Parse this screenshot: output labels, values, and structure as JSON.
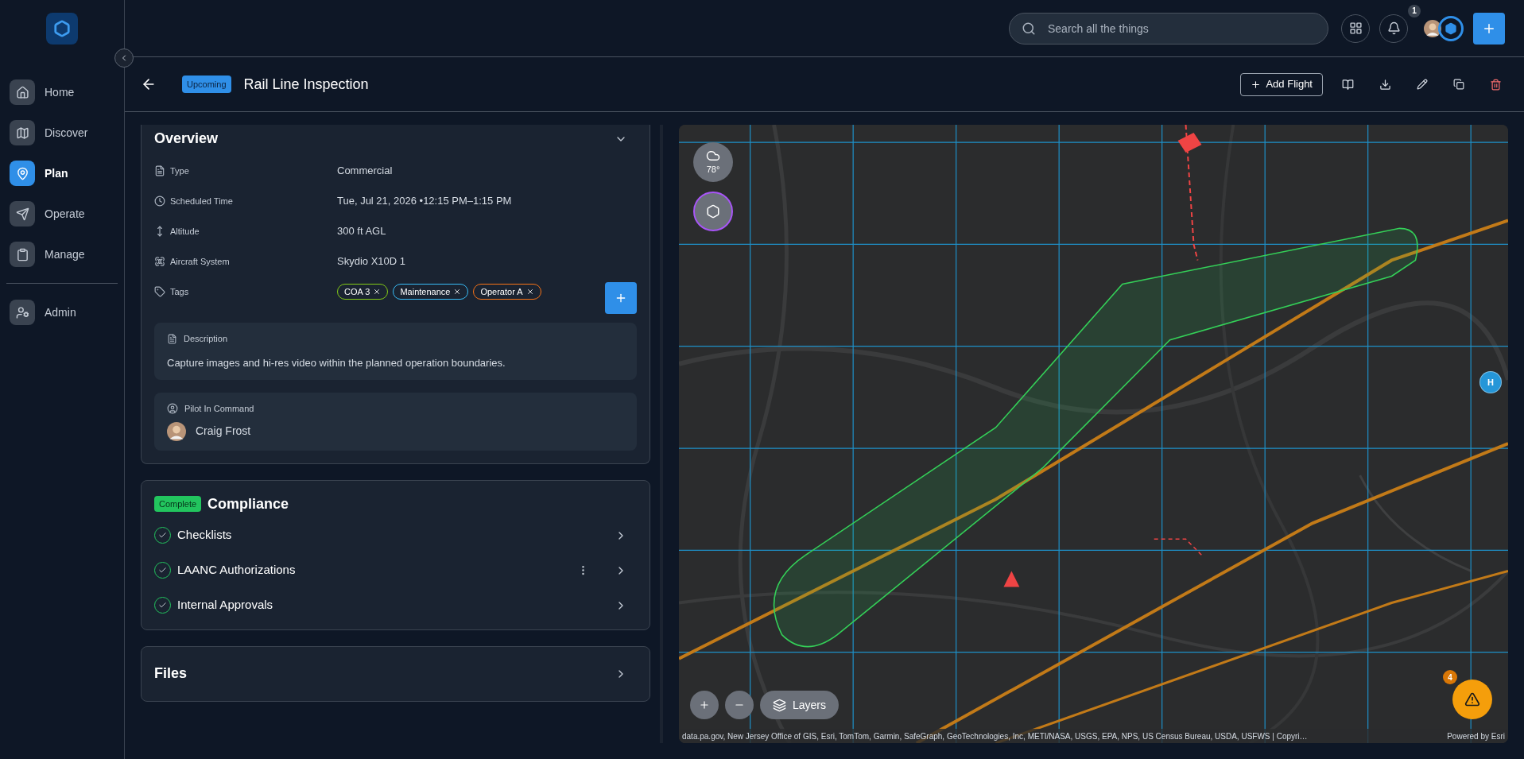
{
  "sidebar": {
    "items": [
      {
        "label": "Home",
        "selected": false
      },
      {
        "label": "Discover",
        "selected": false
      },
      {
        "label": "Plan",
        "selected": true
      },
      {
        "label": "Operate",
        "selected": false
      },
      {
        "label": "Manage",
        "selected": false
      }
    ],
    "footer_items": [
      {
        "label": "Admin",
        "selected": false
      }
    ]
  },
  "topbar": {
    "search": {
      "placeholder": "Search all the things"
    },
    "notification_count": "1"
  },
  "page": {
    "status": "Upcoming",
    "title": "Rail Line Inspection",
    "add_button": "Add Flight"
  },
  "overview": {
    "title": "Overview",
    "expanded": true,
    "fields": [
      {
        "label": "Type",
        "value": "Commercial"
      },
      {
        "label": "Scheduled Time",
        "value": "Tue, Jul 21, 2026 •12:15 PM–1:15 PM"
      },
      {
        "label": "Altitude",
        "value": "300 ft AGL"
      },
      {
        "label": "Aircraft System",
        "value": "Skydio X10D 1"
      }
    ],
    "tags_label": "Tags",
    "tags": [
      {
        "label": "COA 3",
        "color": "#84cc16"
      },
      {
        "label": "Maintenance",
        "color": "#38bdf8"
      },
      {
        "label": "Operator A",
        "color": "#f97316"
      }
    ],
    "description": {
      "label": "Description",
      "text": "Capture images and hi-res video within the planned operation boundaries."
    },
    "pilot": {
      "label": "Pilot In Command",
      "name": "Craig Frost"
    }
  },
  "compliance": {
    "status": "Complete",
    "title": "Compliance",
    "items": [
      {
        "label": "Checklists",
        "done": true,
        "menu": false
      },
      {
        "label": "LAANC Authorizations",
        "done": true,
        "menu": true
      },
      {
        "label": "Internal Approvals",
        "done": true,
        "menu": false
      }
    ]
  },
  "files": {
    "title": "Files"
  },
  "map": {
    "temperature": "78°",
    "marker": "H",
    "alerts": "4",
    "layers_button": "Layers",
    "attribution": "data.pa.gov, New Jersey Office of GIS, Esri, TomTom, Garmin, SafeGraph, GeoTechnologies, Inc, METI/NASA, USGS, EPA, NPS, US Census Bureau, USDA, USFWS | Copyri…",
    "powered_by": "Powered by Esri"
  }
}
